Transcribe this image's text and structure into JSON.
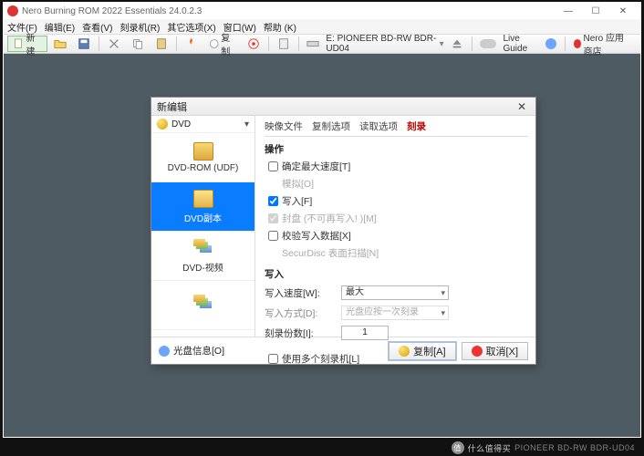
{
  "window": {
    "title": "Nero Burning ROM 2022 Essentials  24.0.2.3",
    "controls": {
      "min": "—",
      "max": "☐",
      "close": "✕"
    }
  },
  "menu": [
    "文件(F)",
    "编辑(E)",
    "查看(V)",
    "刻录机(R)",
    "其它选项(X)",
    "窗口(W)",
    "帮助 (K)"
  ],
  "toolbar": {
    "new_label": "新建",
    "copy_label": "复制",
    "recorder_text": "E: PIONEER BD-RW  BDR-UD04",
    "live_guide": "Live Guide",
    "nero_store": "Nero 应用商店"
  },
  "dialog": {
    "title": "新编辑",
    "close": "✕",
    "sidebar": {
      "disc_type": "DVD",
      "projects": [
        {
          "label": "DVD-ROM (UDF)",
          "key": "dvd-rom-udf",
          "stack": false
        },
        {
          "label": "DVD副本",
          "key": "dvd-copy",
          "stack": false,
          "selected": true
        },
        {
          "label": "DVD-视频",
          "key": "dvd-video",
          "stack": true
        },
        {
          "label": "",
          "key": "next",
          "stack": true
        }
      ]
    },
    "tabs": [
      {
        "label": "映像文件",
        "key": "image"
      },
      {
        "label": "复制选项",
        "key": "copy-opts"
      },
      {
        "label": "读取选项",
        "key": "read-opts"
      },
      {
        "label": "刻录",
        "key": "burn",
        "active": true
      }
    ],
    "burn": {
      "section_action": "操作",
      "opt_max_speed": "确定最大速度[T]",
      "opt_simulate": "模拟[O]",
      "opt_write": "写入[F]",
      "opt_close_disc": "封盘 (不可再写入! )[M]",
      "opt_verify": "校验写入数据[X]",
      "opt_securdisc": "SecurDisc 表面扫描[N]",
      "section_write": "写入",
      "lbl_write_speed": "写入速度[W]:",
      "val_write_speed": "最大",
      "lbl_write_method": "写入方式[D]:",
      "val_write_method": "光盘应按一次刻录",
      "lbl_copies": "刻录份数[I]:",
      "val_copies": "1",
      "opt_multi_burner": "使用多个刻录机[L]",
      "checked": {
        "write": true,
        "verify": false,
        "max_speed": false,
        "multi": false
      }
    },
    "footer": {
      "disc_info": "光盘信息[O]",
      "copy": "复制[A]",
      "cancel": "取消[X]"
    }
  },
  "watermark": {
    "text1": "什么值得买",
    "text2": "PIONEER BD-RW BDR-UD04"
  }
}
